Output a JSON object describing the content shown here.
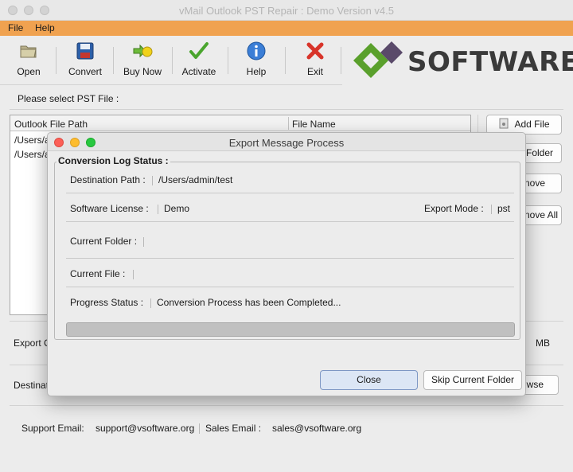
{
  "window": {
    "title": "vMail Outlook PST Repair : Demo Version v4.5"
  },
  "menu": {
    "file": "File",
    "help": "Help"
  },
  "toolbar": {
    "open": "Open",
    "convert": "Convert",
    "buy_now": "Buy Now",
    "activate": "Activate",
    "help": "Help",
    "exit": "Exit"
  },
  "logo": {
    "text": "SOFTWARE",
    "colors": {
      "green": "#5aa02c",
      "purple": "#5a4a6a"
    }
  },
  "main": {
    "select_label": "Please select PST File :",
    "table": {
      "col_path": "Outlook File Path",
      "col_name": "File Name",
      "rows": [
        "/Users/a",
        "/Users/a"
      ]
    },
    "buttons": {
      "add_file": "Add File",
      "add_folder": "Folder",
      "remove": "nove",
      "remove_all": "nove All",
      "browse": "wse"
    },
    "export_label": "Export C",
    "size_unit": "MB",
    "destination_label": "Destinat"
  },
  "footer": {
    "support_label": "Support Email:",
    "support_email": "support@vsoftware.org",
    "sales_label": "Sales Email :",
    "sales_email": "sales@vsoftware.org"
  },
  "dialog": {
    "title": "Export Message Process",
    "group_title": "Conversion Log Status :",
    "destination_path_label": "Destination Path :",
    "destination_path": "/Users/admin/test",
    "license_label": "Software License  :",
    "license": "Demo",
    "export_mode_label": "Export Mode :",
    "export_mode": "pst",
    "current_folder_label": "Current Folder :",
    "current_folder": "",
    "current_file_label": "Current File :",
    "current_file": "",
    "progress_label": "Progress Status :",
    "progress_status": "Conversion Process has been Completed...",
    "progress_fraction": 1.0,
    "close": "Close",
    "skip": "Skip Current Folder"
  },
  "colors": {
    "menubar": "#f0a250",
    "accent_button": "#dce6f5"
  }
}
